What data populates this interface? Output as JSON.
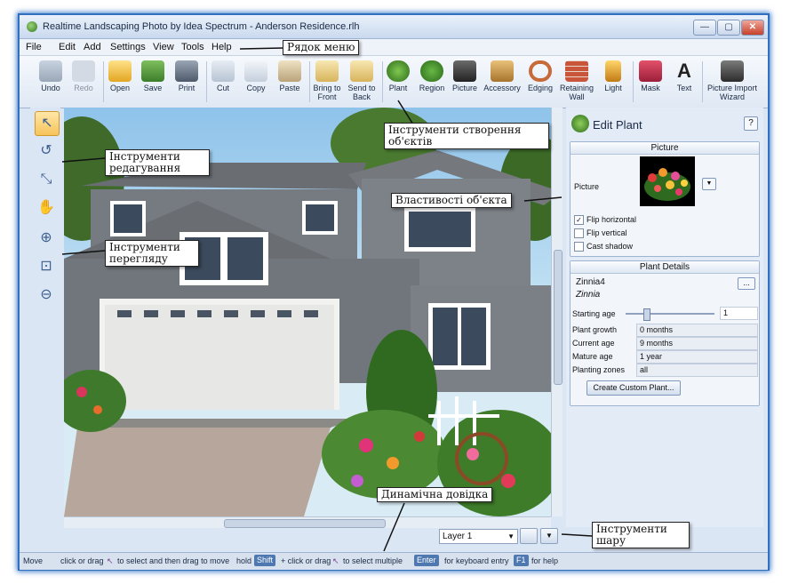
{
  "window": {
    "title": "Realtime Landscaping Photo by Idea Spectrum - Anderson Residence.rlh",
    "minimize": "—",
    "maximize": "▢",
    "close": "✕"
  },
  "menu": [
    "File",
    "Edit",
    "Add",
    "Settings",
    "View",
    "Tools",
    "Help"
  ],
  "toolbar": {
    "undo": "Undo",
    "redo": "Redo",
    "open": "Open",
    "save": "Save",
    "print": "Print",
    "cut": "Cut",
    "copy": "Copy",
    "paste": "Paste",
    "bring_to_front": "Bring to Front",
    "send_to_back": "Send to Back",
    "plant": "Plant",
    "region": "Region",
    "picture": "Picture",
    "accessory": "Accessory",
    "edging": "Edging",
    "retaining_wall": "Retaining Wall",
    "light": "Light",
    "mask": "Mask",
    "text": "Text",
    "picture_import_wizard": "Picture Import Wizard"
  },
  "panel": {
    "title": "Edit Plant",
    "help": "?",
    "picture_header": "Picture",
    "picture_label": "Picture",
    "flip_horizontal": "Flip horizontal",
    "flip_vertical": "Flip vertical",
    "cast_shadow": "Cast shadow",
    "details_header": "Plant Details",
    "plant_name": "Zinnia4",
    "plant_latin": "Zinnia",
    "browse": "...",
    "starting_age_label": "Starting age",
    "starting_age_value": "1",
    "plant_growth_label": "Plant growth",
    "plant_growth_value": "0 months",
    "current_age_label": "Current age",
    "current_age_value": "9 months",
    "mature_age_label": "Mature age",
    "mature_age_value": "1 year",
    "planting_zones_label": "Planting zones",
    "planting_zones_value": "all",
    "create_button": "Create Custom Plant..."
  },
  "layer": {
    "selected": "Layer 1"
  },
  "status": {
    "mode": "Move",
    "t1": "click or drag",
    "t2": "to select and then drag to move",
    "t3": "hold",
    "k1": "Shift",
    "t4": "+ click or drag",
    "t5": "to select multiple",
    "k2": "Enter",
    "t6": "for keyboard entry",
    "k3": "F1",
    "t7": "for help"
  },
  "callouts": {
    "menu_bar": "Рядок меню",
    "create_tools": "Інструменти створення об'єктів",
    "edit_tools": "Інструменти редагування",
    "view_tools": "Інструменти перегляду",
    "properties": "Властивості об'єкта",
    "help": "Динамічна довідка",
    "layer_tools": "Інструменти шару"
  },
  "colors": {
    "accent": "#3a78c8",
    "status_key": "#4e78b0",
    "house": "#6f7579"
  }
}
